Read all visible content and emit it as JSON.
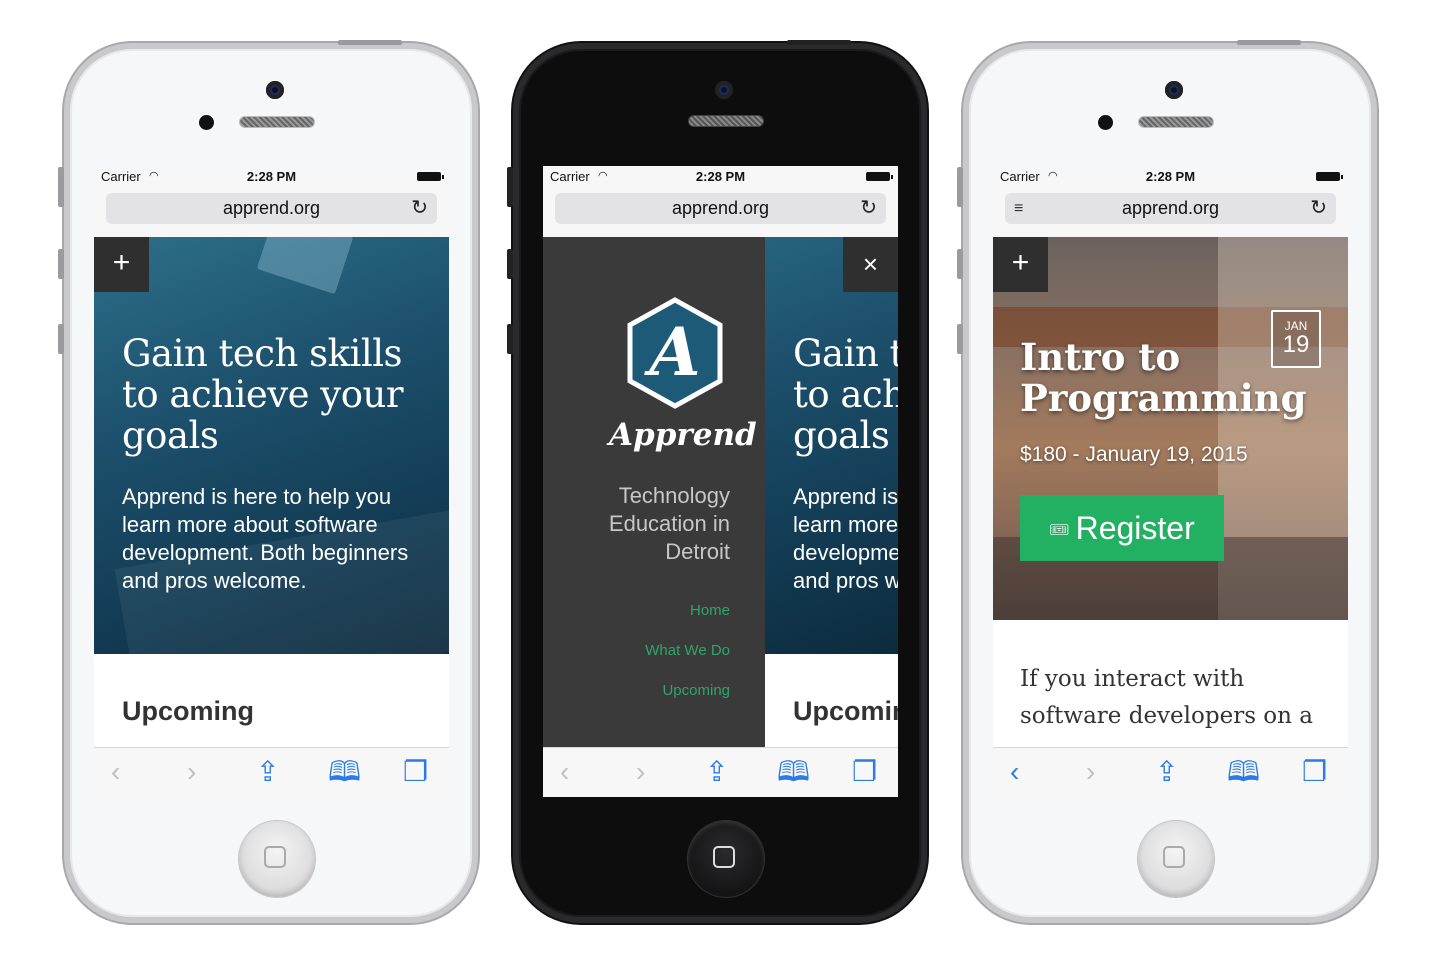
{
  "status": {
    "carrier": "Carrier",
    "time": "2:28 PM"
  },
  "browser": {
    "url": "apprend.org",
    "toolbar_icons": [
      "back-arrow-icon",
      "forward-arrow-icon",
      "share-icon",
      "bookmarks-icon",
      "tabs-icon"
    ]
  },
  "home_page": {
    "menu_button": "+",
    "hero_title": "Gain tech skills to achieve your goals",
    "hero_text": "Apprend is here to help you learn more about software development. Both beginners and pros welcome.",
    "section_title": "Upcoming"
  },
  "menu_page": {
    "close_button": "×",
    "logo_letter": "A",
    "brand": "Apprend",
    "tagline": "Technology Education in Detroit",
    "items": [
      {
        "label": "Home"
      },
      {
        "label": "What We Do"
      },
      {
        "label": "Upcoming"
      }
    ],
    "hero_title": "Gain tech skills to achieve your goals",
    "hero_text": "Apprend is here to help you learn more about software development. Both beginners and pros welcome.",
    "section_title": "Upcoming"
  },
  "event_page": {
    "menu_button": "+",
    "date_month": "JAN",
    "date_day": "19",
    "title": "Intro to Programming",
    "meta": "$180 - January 19, 2015",
    "register_label": "Register",
    "body_text": "If you interact with software developers on a"
  },
  "colors": {
    "accent_green": "#22b163",
    "menu_bg": "#3a3a3a",
    "link_blue": "#2b7ae6",
    "menu_link_green": "#2ea56a"
  }
}
